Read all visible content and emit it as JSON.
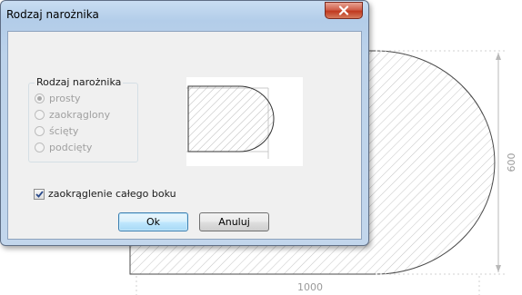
{
  "window": {
    "title": "Rodzaj narożnika"
  },
  "corner_type_group": {
    "caption": "Rodzaj narożnika",
    "options": [
      {
        "label": "prosty",
        "checked": true,
        "enabled": false
      },
      {
        "label": "zaokrąglony",
        "checked": false,
        "enabled": false
      },
      {
        "label": "ścięty",
        "checked": false,
        "enabled": false
      },
      {
        "label": "podcięty",
        "checked": false,
        "enabled": false
      }
    ]
  },
  "round_whole_side": {
    "label": "zaokrąglenie całego boku",
    "checked": true
  },
  "buttons": {
    "ok": "Ok",
    "cancel": "Anuluj"
  },
  "drawing": {
    "width_dimension": "1000",
    "height_dimension": "600"
  },
  "colors": {
    "close_button": "#c73b24",
    "ok_border": "#3c7fb1",
    "hatch": "#c4c4c4"
  }
}
